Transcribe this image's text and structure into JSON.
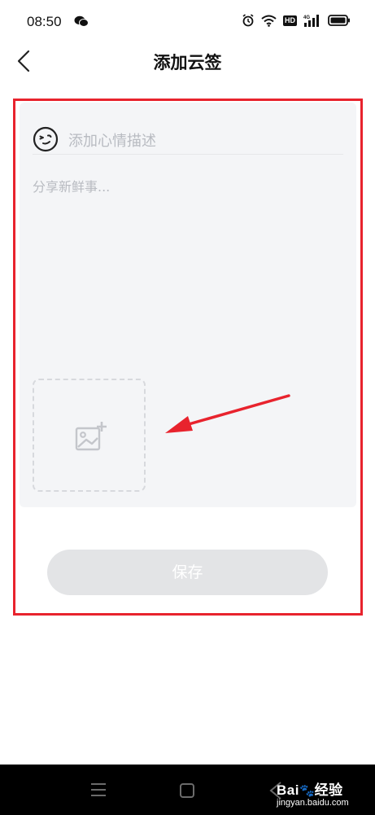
{
  "status_bar": {
    "time": "08:50",
    "network": "4G",
    "hd_badge": "HD",
    "icons": [
      "wechat-icon",
      "alarm-icon",
      "wifi-icon",
      "hd-icon",
      "signal-icon",
      "battery-icon"
    ]
  },
  "header": {
    "title": "添加云签",
    "back_icon": "chevron-left-icon"
  },
  "editor": {
    "mood_icon": "wink-face-icon",
    "mood_placeholder": "添加心情描述",
    "content_placeholder": "分享新鲜事...",
    "add_image_icon": "add-image-icon"
  },
  "save_button": {
    "label": "保存"
  },
  "nav_bar": {
    "icons": [
      "menu-icon",
      "home-icon",
      "back-icon"
    ]
  },
  "watermark": {
    "brand": "Bai",
    "brand_suffix": "经验",
    "url": "jingyan.baidu.com"
  },
  "colors": {
    "highlight": "#e8232d",
    "card_background": "#f4f5f7",
    "placeholder_text": "#b8bbc1",
    "button_disabled": "#e3e4e6",
    "nav_background": "#000000"
  }
}
